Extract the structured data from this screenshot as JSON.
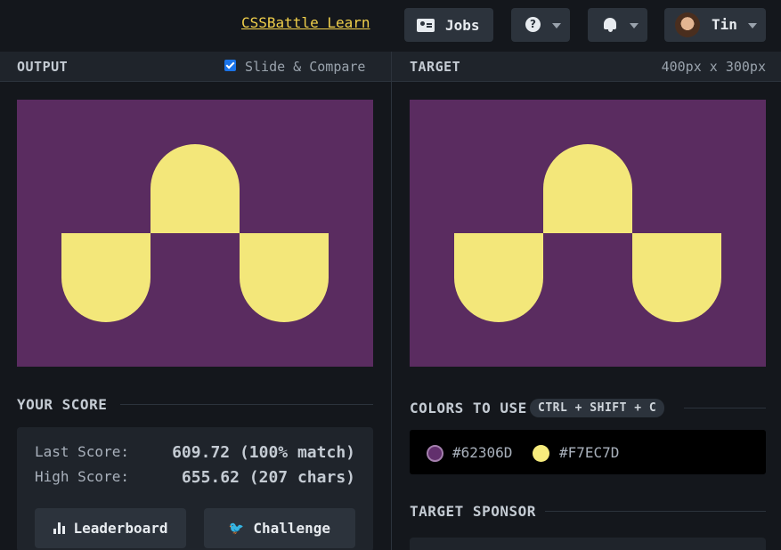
{
  "topbar": {
    "learn_link": "CSSBattle Learn",
    "jobs_label": "Jobs",
    "help_glyph": "?",
    "user_name": "Tin",
    "icons": [
      "id-card-icon",
      "help-icon",
      "bell-icon",
      "chevron-down-icon"
    ]
  },
  "output_panel": {
    "title": "OUTPUT",
    "slide_compare_label": "Slide & Compare",
    "slide_compare_checked": true
  },
  "target_panel": {
    "title": "TARGET",
    "dimensions": "400px x 300px"
  },
  "score": {
    "title": "YOUR SCORE",
    "last_label": "Last Score:",
    "last_value": "609.72 (100% match)",
    "high_label": "High Score:",
    "high_value": "655.62 (207 chars)",
    "leaderboard_label": "Leaderboard",
    "challenge_label": "Challenge"
  },
  "colors": {
    "title": "COLORS TO USE",
    "shortcut": "CTRL + SHIFT + C",
    "list": [
      {
        "hex": "#62306D"
      },
      {
        "hex": "#F7EC7D"
      }
    ]
  },
  "sponsor": {
    "title": "TARGET SPONSOR"
  },
  "theme": {
    "canvas_bg": "#5a2c60",
    "shape_fill": "#f3e77a",
    "accent": "#f1d04b"
  }
}
